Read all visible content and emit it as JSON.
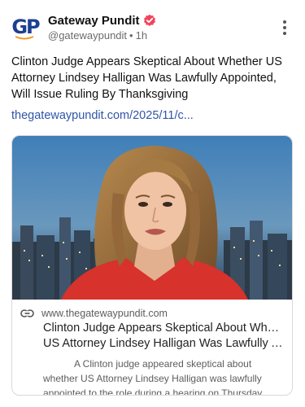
{
  "author": {
    "name": "Gateway Pundit",
    "handle": "@gatewaypundit",
    "time": "1h",
    "avatar_text": "GP"
  },
  "post": {
    "text": "Clinton Judge Appears Skeptical About Whether US Attorney Lindsey Halligan Was Lawfully Appointed, Will Issue Ruling By Thanksgiving",
    "link_text": "thegatewaypundit.com/2025/11/c..."
  },
  "card": {
    "domain": "www.thegatewaypundit.com",
    "title_line1": "Clinton Judge Appears Skeptical About Whether",
    "title_line2": "US Attorney Lindsey Halligan Was Lawfully Ap...",
    "description": "A Clinton judge appeared skeptical about whether US Attorney Lindsey Halligan was lawfully appointed to the role during a hearing on Thursday."
  },
  "icons": {
    "verified": "verified-badge-icon",
    "more": "more-vertical-icon",
    "link": "link-icon"
  },
  "colors": {
    "brand_blue": "#1d3f8f",
    "brand_orange": "#f39a1e",
    "verified": "#f0455a",
    "link": "#2f55a8"
  }
}
